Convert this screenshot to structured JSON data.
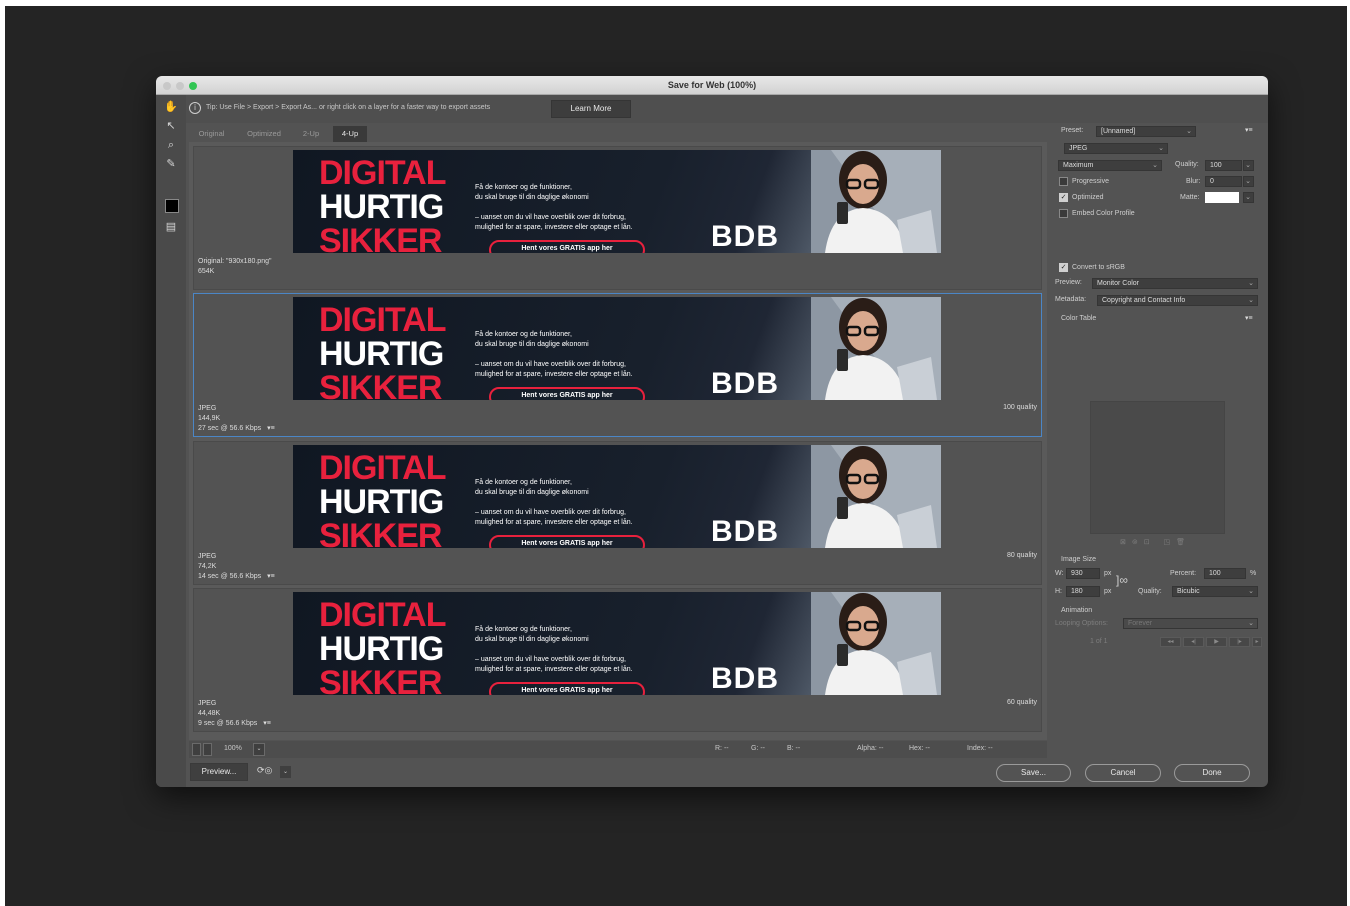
{
  "window": {
    "title": "Save for Web (100%)"
  },
  "tip": {
    "text": "Tip: Use File > Export > Export As... or right click on a layer for a faster way to export assets",
    "learn_more": "Learn More"
  },
  "tabs": [
    "Original",
    "Optimized",
    "2-Up",
    "4-Up"
  ],
  "active_tab": "4-Up",
  "banner": {
    "line1": "DIGITAL",
    "line2": "HURTIG",
    "line3": "SIKKER",
    "copy1a": "Få de kontoer og de funktioner,",
    "copy1b": "du skal bruge til din daglige økonomi",
    "copy2a": "– uanset om du vil have overblik over dit forbrug,",
    "copy2b": "mulighed for at spare, investere eller optage et lån.",
    "cta": "Hent vores GRATIS app her",
    "logo": "BDB"
  },
  "panes": [
    {
      "format": "Original: \"930x180.png\"",
      "size": "654K",
      "time": "",
      "quality": ""
    },
    {
      "format": "JPEG",
      "size": "144,9K",
      "time": "27 sec @ 56.6 Kbps",
      "quality": "100 quality"
    },
    {
      "format": "JPEG",
      "size": "74,2K",
      "time": "14 sec @ 56.6 Kbps",
      "quality": "80 quality"
    },
    {
      "format": "JPEG",
      "size": "44,48K",
      "time": "9 sec @ 56.6 Kbps",
      "quality": "60 quality"
    }
  ],
  "status": {
    "zoom": "100%",
    "r": "R: --",
    "g": "G: --",
    "b": "B: --",
    "alpha": "Alpha: --",
    "hex": "Hex: --",
    "index": "Index: --"
  },
  "buttons": {
    "preview": "Preview...",
    "save": "Save...",
    "cancel": "Cancel",
    "done": "Done"
  },
  "settings": {
    "preset_label": "Preset:",
    "preset_value": "[Unnamed]",
    "format": "JPEG",
    "compression": "Maximum",
    "quality_label": "Quality:",
    "quality_value": "100",
    "progressive": "Progressive",
    "blur_label": "Blur:",
    "blur_value": "0",
    "optimized": "Optimized",
    "matte_label": "Matte:",
    "embed": "Embed Color Profile",
    "convert": "Convert to sRGB",
    "preview_label": "Preview:",
    "preview_value": "Monitor Color",
    "metadata_label": "Metadata:",
    "metadata_value": "Copyright and Contact Info",
    "color_table": "Color Table",
    "image_size": "Image Size",
    "w_label": "W:",
    "w_value": "930",
    "h_label": "H:",
    "h_value": "180",
    "px": "px",
    "percent_label": "Percent:",
    "percent_value": "100",
    "pct": "%",
    "resample_label": "Quality:",
    "resample_value": "Bicubic",
    "animation": "Animation",
    "looping_label": "Looping Options:",
    "looping_value": "Forever",
    "frame": "1 of 1"
  },
  "colors": {
    "accent": "#e8213d",
    "selection": "#4b86c6",
    "window_bg": "#535353"
  }
}
